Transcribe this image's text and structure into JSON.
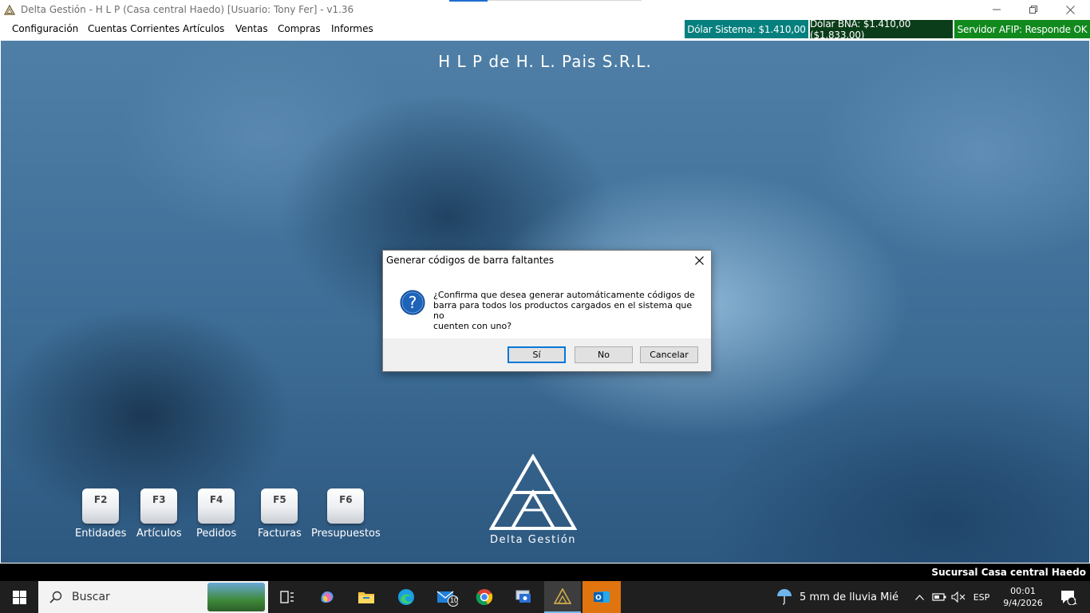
{
  "window": {
    "title": "Delta Gestión - H L P (Casa central Haedo) [Usuario: Tony Fer] - v1.36"
  },
  "menu": {
    "items": [
      {
        "label": "Configuración"
      },
      {
        "label": "Cuentas Corrientes"
      },
      {
        "label": "Artículos"
      },
      {
        "label": "Ventas"
      },
      {
        "label": "Compras"
      },
      {
        "label": "Informes"
      }
    ]
  },
  "status_chips": {
    "dolar_sistema": "Dólar Sistema: $1.410,00",
    "dolar_bna": "Dólar BNA: $1.410,00 ($1.833,00)",
    "servidor_afip": "Servidor AFIP:  Responde OK",
    "colors": {
      "sistema": "#06807e",
      "bna": "#0b3d1a",
      "afip": "#11891d"
    }
  },
  "main": {
    "company_name": "H L P de H. L. Pais S.R.L.",
    "shortcuts": [
      {
        "key": "F2",
        "label": "Entidades"
      },
      {
        "key": "F3",
        "label": "Artículos"
      },
      {
        "key": "F4",
        "label": "Pedidos"
      },
      {
        "key": "F5",
        "label": "Facturas"
      },
      {
        "key": "F6",
        "label": "Presupuestos"
      }
    ],
    "logo_text": "Delta Gestión"
  },
  "dialog": {
    "title": "Generar códigos de barra faltantes",
    "message_lines": [
      "¿Confirma que desea generar automáticamente códigos de",
      "barra para todos los productos cargados en el sistema que no",
      "cuenten con uno?"
    ],
    "icon": "question-icon",
    "buttons": {
      "yes": "Sí",
      "no": "No",
      "cancel": "Cancelar"
    }
  },
  "status_strip": {
    "branch": "Sucursal Casa central Haedo"
  },
  "taskbar": {
    "search_placeholder": "Buscar",
    "mail_badge": "10",
    "weather": "5 mm de lluvia Mié",
    "language": "ESP",
    "time": "00:01",
    "date": "9/4/2026",
    "notification_count": "1"
  }
}
